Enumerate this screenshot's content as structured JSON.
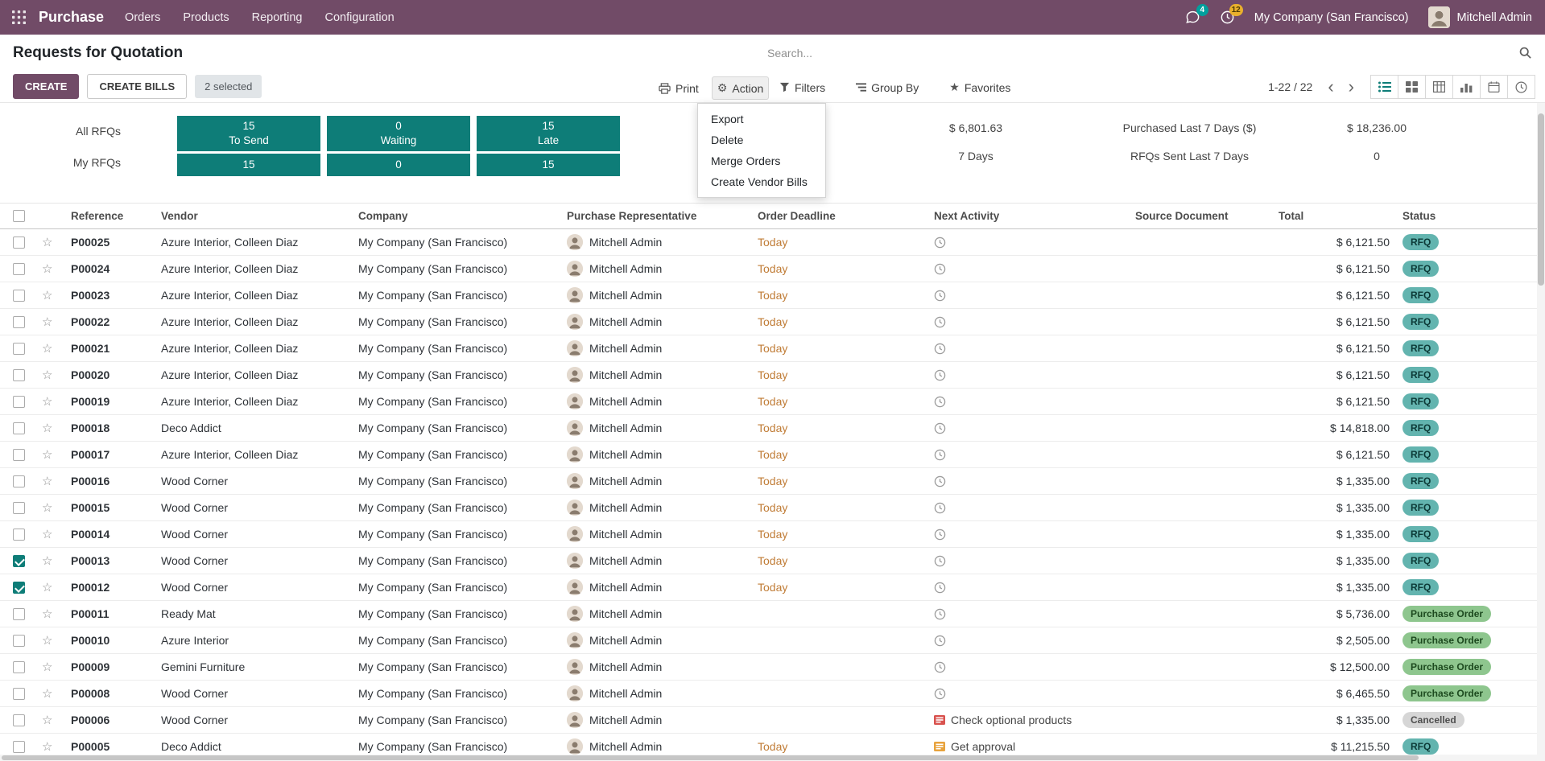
{
  "navbar": {
    "brand": "Purchase",
    "menus": [
      {
        "label": "Orders"
      },
      {
        "label": "Products"
      },
      {
        "label": "Reporting"
      },
      {
        "label": "Configuration"
      }
    ],
    "messages_badge": "4",
    "activities_badge": "12",
    "company": "My Company (San Francisco)",
    "user": "Mitchell Admin"
  },
  "header": {
    "title": "Requests for Quotation",
    "search_placeholder": "Search..."
  },
  "control_panel": {
    "create": "CREATE",
    "create_bills": "CREATE BILLS",
    "selected": "2 selected",
    "print": "Print",
    "action": "Action",
    "filters": "Filters",
    "group_by": "Group By",
    "favorites": "Favorites",
    "pager": "1-22 / 22"
  },
  "action_menu": {
    "items": [
      "Export",
      "Delete",
      "Merge Orders",
      "Create Vendor Bills"
    ]
  },
  "dashboard": {
    "row_labels": [
      "All RFQs",
      "My RFQs"
    ],
    "boxes": [
      {
        "all_value": "15",
        "label": "To Send",
        "my_value": "15"
      },
      {
        "all_value": "0",
        "label": "Waiting",
        "my_value": "0"
      },
      {
        "all_value": "15",
        "label": "Late",
        "my_value": "15"
      }
    ],
    "stats": {
      "avg_value_top": "$ 6,801.63",
      "avg_value_bottom": "7  Days",
      "purchased_label": "Purchased Last 7 Days ($)",
      "purchased_value": "$ 18,236.00",
      "sent_label": "RFQs Sent Last 7 Days",
      "sent_value": "0"
    }
  },
  "table": {
    "columns": [
      "Reference",
      "Vendor",
      "Company",
      "Purchase Representative",
      "Order Deadline",
      "Next Activity",
      "Source Document",
      "Total",
      "Status"
    ],
    "rows": [
      {
        "reference": "P00025",
        "vendor": "Azure Interior, Colleen Diaz",
        "company": "My Company (San Francisco)",
        "representative": "Mitchell Admin",
        "deadline": "Today",
        "activity_text": "",
        "activity_icon": "clock",
        "source": "",
        "total": "$ 6,121.50",
        "status": "RFQ",
        "status_class": "rfq",
        "decoration": "info",
        "checked": false
      },
      {
        "reference": "P00024",
        "vendor": "Azure Interior, Colleen Diaz",
        "company": "My Company (San Francisco)",
        "representative": "Mitchell Admin",
        "deadline": "Today",
        "activity_text": "",
        "activity_icon": "clock",
        "source": "",
        "total": "$ 6,121.50",
        "status": "RFQ",
        "status_class": "rfq",
        "decoration": "info",
        "checked": false
      },
      {
        "reference": "P00023",
        "vendor": "Azure Interior, Colleen Diaz",
        "company": "My Company (San Francisco)",
        "representative": "Mitchell Admin",
        "deadline": "Today",
        "activity_text": "",
        "activity_icon": "clock",
        "source": "",
        "total": "$ 6,121.50",
        "status": "RFQ",
        "status_class": "rfq",
        "decoration": "info",
        "checked": false
      },
      {
        "reference": "P00022",
        "vendor": "Azure Interior, Colleen Diaz",
        "company": "My Company (San Francisco)",
        "representative": "Mitchell Admin",
        "deadline": "Today",
        "activity_text": "",
        "activity_icon": "clock",
        "source": "",
        "total": "$ 6,121.50",
        "status": "RFQ",
        "status_class": "rfq",
        "decoration": "info",
        "checked": false
      },
      {
        "reference": "P00021",
        "vendor": "Azure Interior, Colleen Diaz",
        "company": "My Company (San Francisco)",
        "representative": "Mitchell Admin",
        "deadline": "Today",
        "activity_text": "",
        "activity_icon": "clock",
        "source": "",
        "total": "$ 6,121.50",
        "status": "RFQ",
        "status_class": "rfq",
        "decoration": "info",
        "checked": false
      },
      {
        "reference": "P00020",
        "vendor": "Azure Interior, Colleen Diaz",
        "company": "My Company (San Francisco)",
        "representative": "Mitchell Admin",
        "deadline": "Today",
        "activity_text": "",
        "activity_icon": "clock",
        "source": "",
        "total": "$ 6,121.50",
        "status": "RFQ",
        "status_class": "rfq",
        "decoration": "info",
        "checked": false
      },
      {
        "reference": "P00019",
        "vendor": "Azure Interior, Colleen Diaz",
        "company": "My Company (San Francisco)",
        "representative": "Mitchell Admin",
        "deadline": "Today",
        "activity_text": "",
        "activity_icon": "clock",
        "source": "",
        "total": "$ 6,121.50",
        "status": "RFQ",
        "status_class": "rfq",
        "decoration": "info",
        "checked": false
      },
      {
        "reference": "P00018",
        "vendor": "Deco Addict",
        "company": "My Company (San Francisco)",
        "representative": "Mitchell Admin",
        "deadline": "Today",
        "activity_text": "",
        "activity_icon": "clock",
        "source": "",
        "total": "$ 14,818.00",
        "status": "RFQ",
        "status_class": "rfq",
        "decoration": "info",
        "checked": false
      },
      {
        "reference": "P00017",
        "vendor": "Azure Interior, Colleen Diaz",
        "company": "My Company (San Francisco)",
        "representative": "Mitchell Admin",
        "deadline": "Today",
        "activity_text": "",
        "activity_icon": "clock",
        "source": "",
        "total": "$ 6,121.50",
        "status": "RFQ",
        "status_class": "rfq",
        "decoration": "info",
        "checked": false
      },
      {
        "reference": "P00016",
        "vendor": "Wood Corner",
        "company": "My Company (San Francisco)",
        "representative": "Mitchell Admin",
        "deadline": "Today",
        "activity_text": "",
        "activity_icon": "clock",
        "source": "",
        "total": "$ 1,335.00",
        "status": "RFQ",
        "status_class": "rfq",
        "decoration": "info",
        "checked": false
      },
      {
        "reference": "P00015",
        "vendor": "Wood Corner",
        "company": "My Company (San Francisco)",
        "representative": "Mitchell Admin",
        "deadline": "Today",
        "activity_text": "",
        "activity_icon": "clock",
        "source": "",
        "total": "$ 1,335.00",
        "status": "RFQ",
        "status_class": "rfq",
        "decoration": "info",
        "checked": false
      },
      {
        "reference": "P00014",
        "vendor": "Wood Corner",
        "company": "My Company (San Francisco)",
        "representative": "Mitchell Admin",
        "deadline": "Today",
        "activity_text": "",
        "activity_icon": "clock",
        "source": "",
        "total": "$ 1,335.00",
        "status": "RFQ",
        "status_class": "rfq",
        "decoration": "info",
        "checked": false
      },
      {
        "reference": "P00013",
        "vendor": "Wood Corner",
        "company": "My Company (San Francisco)",
        "representative": "Mitchell Admin",
        "deadline": "Today",
        "activity_text": "",
        "activity_icon": "clock",
        "source": "",
        "total": "$ 1,335.00",
        "status": "RFQ",
        "status_class": "rfq",
        "decoration": "info",
        "checked": true
      },
      {
        "reference": "P00012",
        "vendor": "Wood Corner",
        "company": "My Company (San Francisco)",
        "representative": "Mitchell Admin",
        "deadline": "Today",
        "activity_text": "",
        "activity_icon": "clock",
        "source": "",
        "total": "$ 1,335.00",
        "status": "RFQ",
        "status_class": "rfq",
        "decoration": "info",
        "checked": true
      },
      {
        "reference": "P00011",
        "vendor": "Ready Mat",
        "company": "My Company (San Francisco)",
        "representative": "Mitchell Admin",
        "deadline": "",
        "activity_text": "",
        "activity_icon": "clock",
        "source": "",
        "total": "$ 5,736.00",
        "status": "Purchase Order",
        "status_class": "po",
        "decoration": "normal",
        "checked": false
      },
      {
        "reference": "P00010",
        "vendor": "Azure Interior",
        "company": "My Company (San Francisco)",
        "representative": "Mitchell Admin",
        "deadline": "",
        "activity_text": "",
        "activity_icon": "clock",
        "source": "",
        "total": "$ 2,505.00",
        "status": "Purchase Order",
        "status_class": "po",
        "decoration": "normal",
        "checked": false
      },
      {
        "reference": "P00009",
        "vendor": "Gemini Furniture",
        "company": "My Company (San Francisco)",
        "representative": "Mitchell Admin",
        "deadline": "",
        "activity_text": "",
        "activity_icon": "clock",
        "source": "",
        "total": "$ 12,500.00",
        "status": "Purchase Order",
        "status_class": "po",
        "decoration": "normal",
        "checked": false
      },
      {
        "reference": "P00008",
        "vendor": "Wood Corner",
        "company": "My Company (San Francisco)",
        "representative": "Mitchell Admin",
        "deadline": "",
        "activity_text": "",
        "activity_icon": "clock",
        "source": "",
        "total": "$ 6,465.50",
        "status": "Purchase Order",
        "status_class": "po",
        "decoration": "normal",
        "checked": false
      },
      {
        "reference": "P00006",
        "vendor": "Wood Corner",
        "company": "My Company (San Francisco)",
        "representative": "Mitchell Admin",
        "deadline": "",
        "activity_text": "Check optional products",
        "activity_icon": "alert-red",
        "source": "",
        "total": "$ 1,335.00",
        "status": "Cancelled",
        "status_class": "cancelled",
        "decoration": "muted",
        "checked": false
      },
      {
        "reference": "P00005",
        "vendor": "Deco Addict",
        "company": "My Company (San Francisco)",
        "representative": "Mitchell Admin",
        "deadline": "Today",
        "activity_text": "Get approval",
        "activity_icon": "alert-yellow",
        "source": "",
        "total": "$ 11,215.50",
        "status": "RFQ",
        "status_class": "rfq",
        "decoration": "info",
        "checked": false
      }
    ]
  }
}
